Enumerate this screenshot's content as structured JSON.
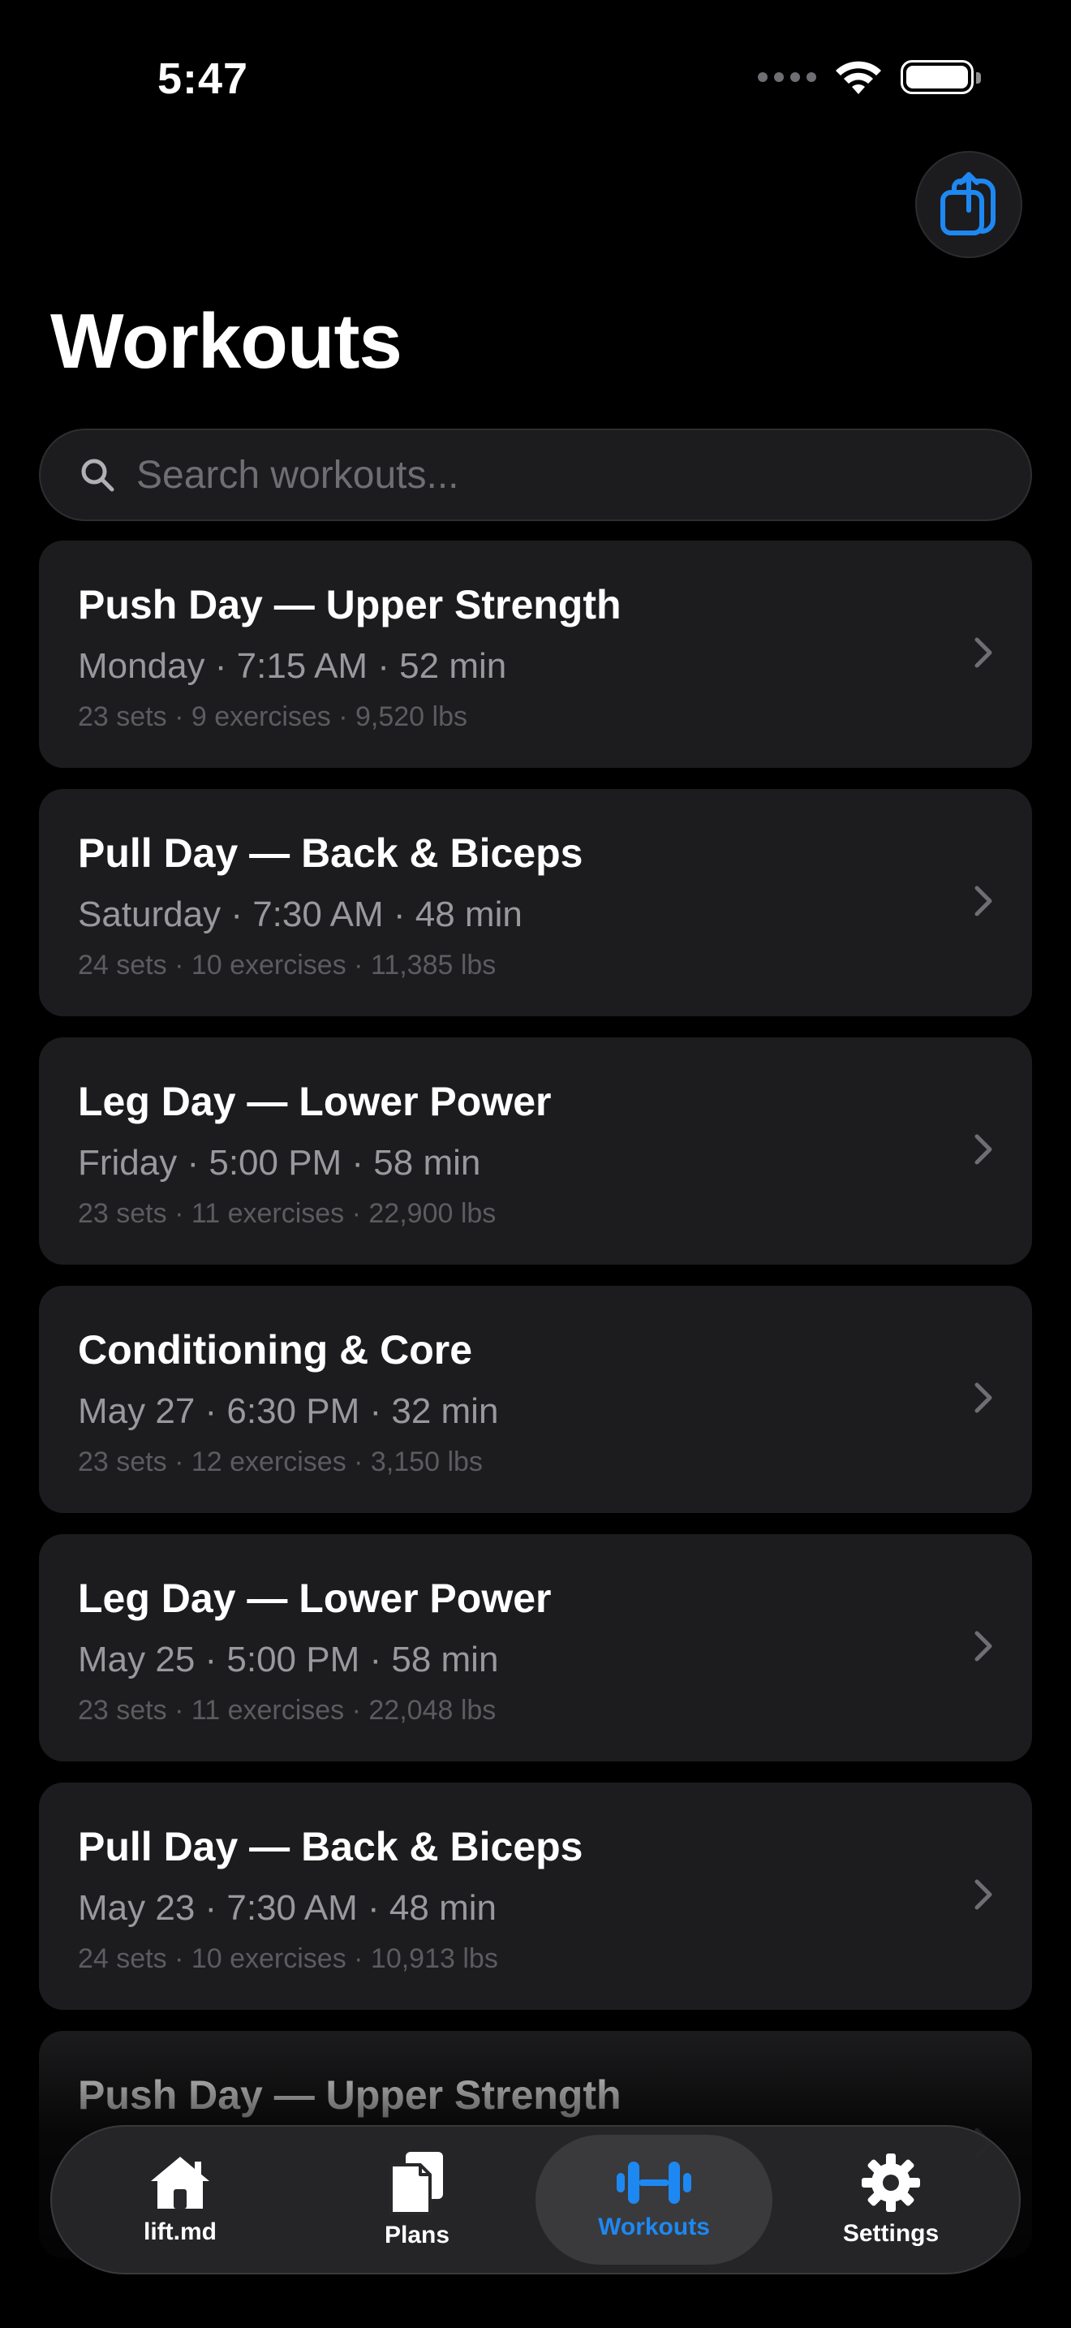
{
  "status_bar": {
    "time": "5:47"
  },
  "header": {
    "title": "Workouts"
  },
  "search": {
    "placeholder": "Search workouts..."
  },
  "workouts": [
    {
      "title": "Push Day — Upper Strength",
      "meta": "Monday  ·  7:15 AM  ·  52 min",
      "sub": "23 sets · 9 exercises · 9,520 lbs"
    },
    {
      "title": "Pull Day — Back & Biceps",
      "meta": "Saturday  ·  7:30 AM  ·  48 min",
      "sub": "24 sets · 10 exercises · 11,385 lbs"
    },
    {
      "title": "Leg Day — Lower Power",
      "meta": "Friday  ·  5:00 PM  ·  58 min",
      "sub": "23 sets · 11 exercises · 22,900 lbs"
    },
    {
      "title": "Conditioning & Core",
      "meta": "May 27  ·  6:30 PM  ·  32 min",
      "sub": "23 sets · 12 exercises · 3,150 lbs"
    },
    {
      "title": "Leg Day — Lower Power",
      "meta": "May 25  ·  5:00 PM  ·  58 min",
      "sub": "23 sets · 11 exercises · 22,048 lbs"
    },
    {
      "title": "Pull Day — Back & Biceps",
      "meta": "May 23  ·  7:30 AM  ·  48 min",
      "sub": "24 sets · 10 exercises · 10,913 lbs"
    },
    {
      "title": "Push Day — Upper Strength",
      "meta": "",
      "sub": ""
    }
  ],
  "tabs": [
    {
      "label": "lift.md",
      "icon": "house-icon"
    },
    {
      "label": "Plans",
      "icon": "documents-icon"
    },
    {
      "label": "Workouts",
      "icon": "dumbbell-icon",
      "active": true
    },
    {
      "label": "Settings",
      "icon": "gear-icon"
    }
  ],
  "colors": {
    "accent": "#1e88f2",
    "card": "#1c1c1e",
    "background": "#000000"
  }
}
